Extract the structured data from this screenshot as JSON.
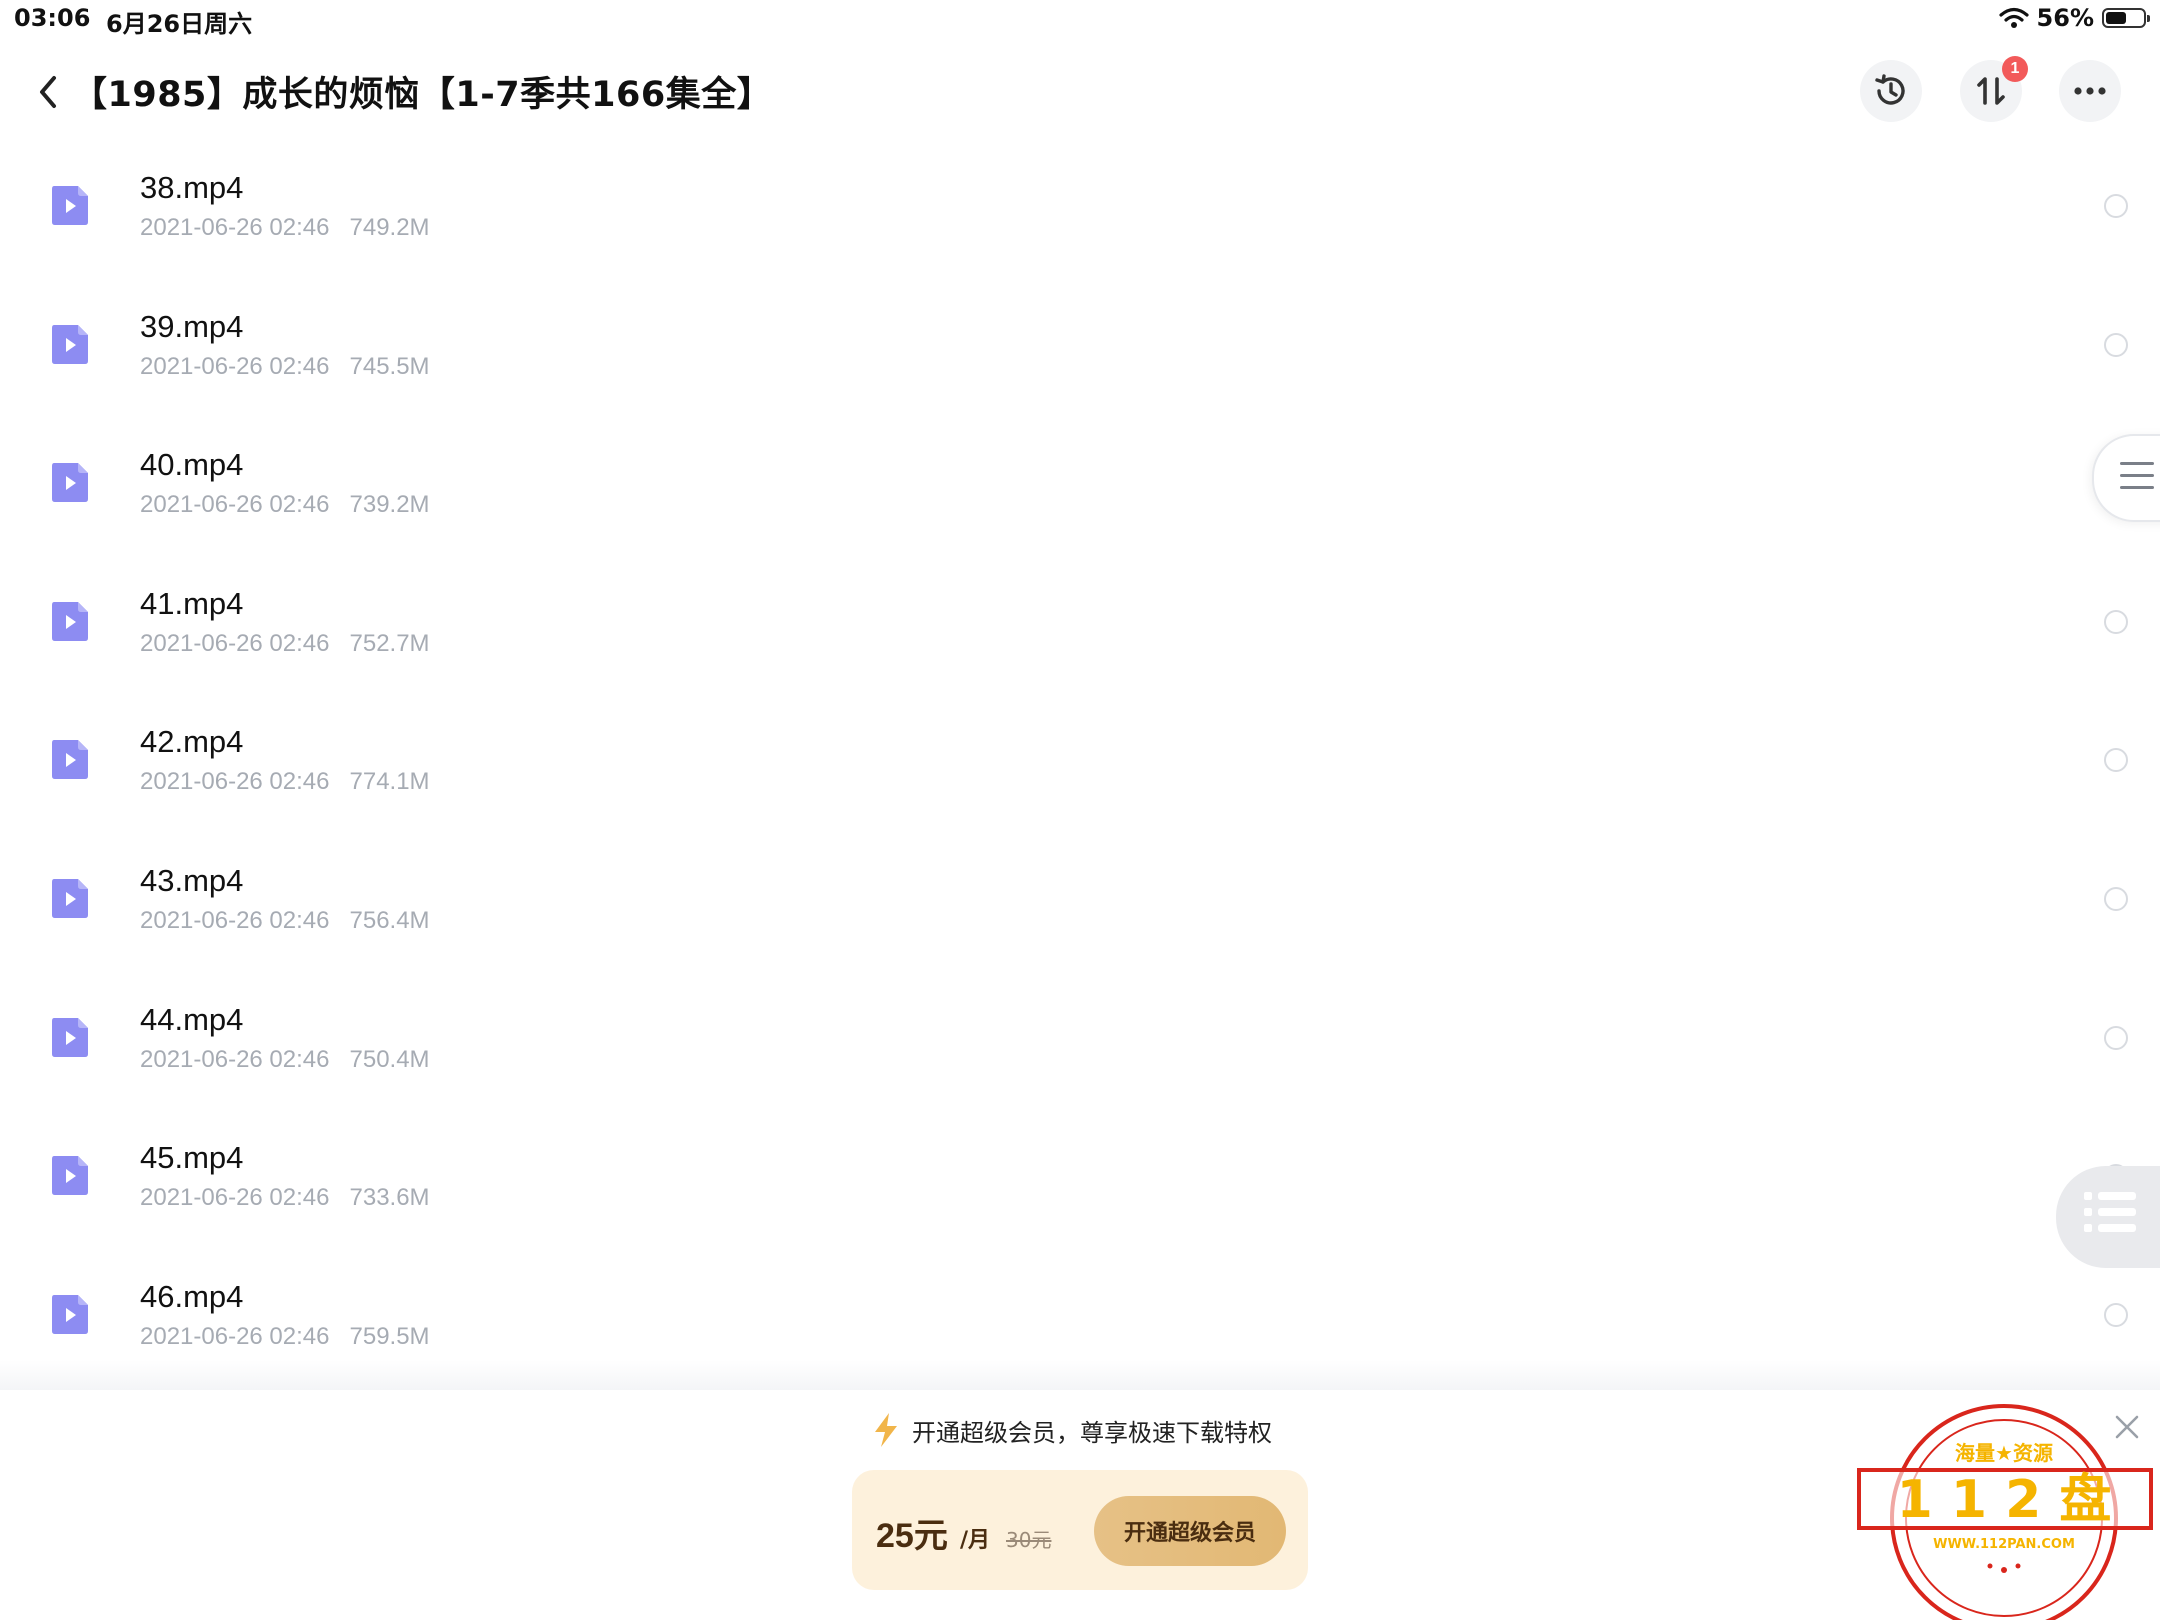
{
  "status_bar": {
    "time": "03:06",
    "date": "6月26日周六",
    "battery": "56%",
    "battery_level": 0.56
  },
  "header": {
    "title": "【1985】成长的烦恼【1-7季共166集全】",
    "transfer_badge": "1"
  },
  "files": [
    {
      "name": "38.mp4",
      "date": "2021-06-26 02:46",
      "size": "749.2M"
    },
    {
      "name": "39.mp4",
      "date": "2021-06-26 02:46",
      "size": "745.5M"
    },
    {
      "name": "40.mp4",
      "date": "2021-06-26 02:46",
      "size": "739.2M"
    },
    {
      "name": "41.mp4",
      "date": "2021-06-26 02:46",
      "size": "752.7M"
    },
    {
      "name": "42.mp4",
      "date": "2021-06-26 02:46",
      "size": "774.1M"
    },
    {
      "name": "43.mp4",
      "date": "2021-06-26 02:46",
      "size": "756.4M"
    },
    {
      "name": "44.mp4",
      "date": "2021-06-26 02:46",
      "size": "750.4M"
    },
    {
      "name": "45.mp4",
      "date": "2021-06-26 02:46",
      "size": "733.6M"
    },
    {
      "name": "46.mp4",
      "date": "2021-06-26 02:46",
      "size": "759.5M"
    }
  ],
  "promo": {
    "tip": "开通超级会员，尊享极速下载特权",
    "price": "25元",
    "per": "/月",
    "old_price": "30元",
    "cta": "开通超级会员"
  },
  "watermark": {
    "top_text": "海量★资源",
    "main_text": "1 1 2 盘",
    "url_text": "WWW.112PAN.COM"
  },
  "colors": {
    "file_icon": "#8d8cf2",
    "badge": "#f25a5a",
    "promo_bg": "#fdf1dc",
    "cta": "#e4bd7d",
    "seal": "#d9261c",
    "seal_text": "#f5b400"
  },
  "icons": {
    "back": "chevron-left-icon",
    "history": "history-icon",
    "transfer": "transfer-icon",
    "more": "more-icon",
    "file": "video-file-icon",
    "lightning": "lightning-icon",
    "close": "close-icon",
    "menu": "menu-icon",
    "list": "list-view-icon"
  }
}
